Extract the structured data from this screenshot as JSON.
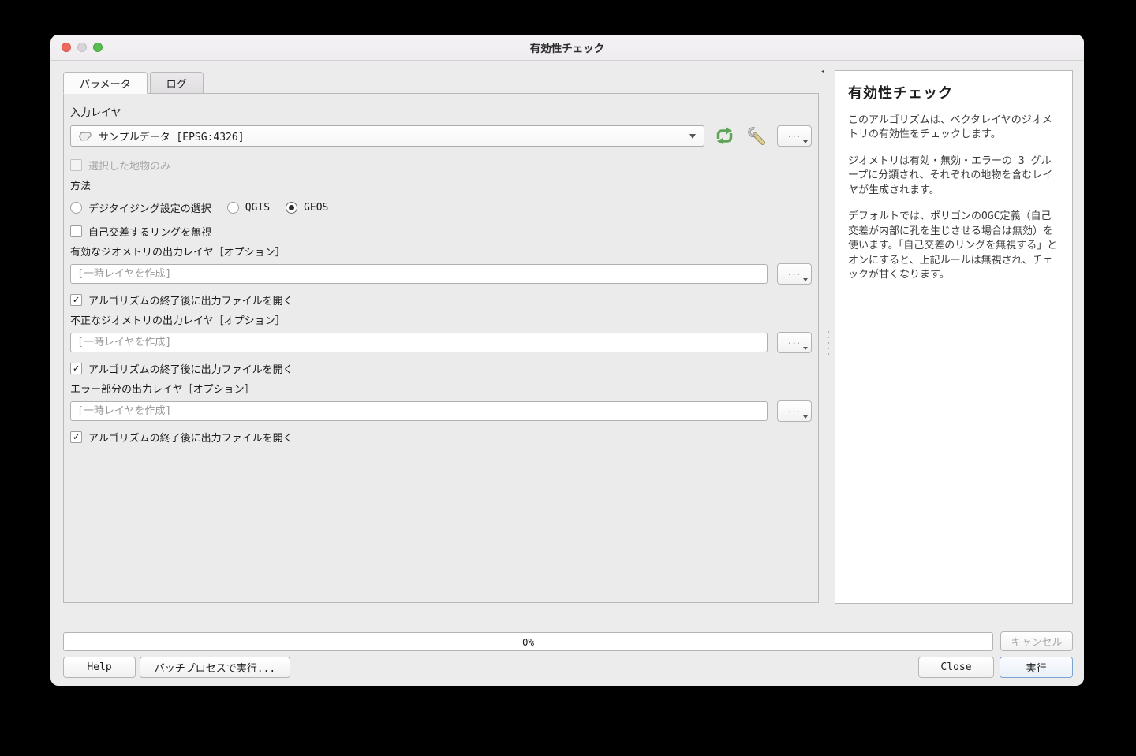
{
  "window": {
    "title": "有効性チェック"
  },
  "tabs": [
    {
      "label": "パラメータ",
      "active": true
    },
    {
      "label": "ログ",
      "active": false
    }
  ],
  "form": {
    "dots_label": "···",
    "input_layer": {
      "label": "入力レイヤ",
      "value": "サンプルデータ [EPSG:4326]"
    },
    "selected_only": {
      "label": "選択した地物のみ",
      "checked": false,
      "disabled": true
    },
    "method": {
      "label": "方法",
      "options": [
        {
          "label": "デジタイジング設定の選択",
          "selected": false
        },
        {
          "label": "QGIS",
          "selected": false
        },
        {
          "label": "GEOS",
          "selected": true
        }
      ]
    },
    "ignore_ring": {
      "label": "自己交差するリングを無視",
      "checked": false
    },
    "valid_output": {
      "label": "有効なジオメトリの出力レイヤ［オプション］",
      "placeholder": "[一時レイヤを作成]"
    },
    "invalid_output": {
      "label": "不正なジオメトリの出力レイヤ［オプション］",
      "placeholder": "[一時レイヤを作成]"
    },
    "error_output": {
      "label": "エラー部分の出力レイヤ［オプション］",
      "placeholder": "[一時レイヤを作成]"
    },
    "open_after": {
      "label": "アルゴリズムの終了後に出力ファイルを開く",
      "checked": true
    }
  },
  "help_panel": {
    "title": "有効性チェック",
    "paragraphs": [
      "このアルゴリズムは、ベクタレイヤのジオメトリの有効性をチェックします。",
      "ジオメトリは有効・無効・エラーの 3 グループに分類され、それぞれの地物を含むレイヤが生成されます。",
      "デフォルトでは、ポリゴンのOGC定義（自己交差が内部に孔を生じさせる場合は無効）を使います。「自己交差のリングを無視する」とオンにすると、上記ルールは無視され、チェックが甘くなります。"
    ]
  },
  "footer": {
    "progress": "0%",
    "cancel_label": "キャンセル",
    "help_label": "Help",
    "batch_label": "バッチプロセスで実行...",
    "close_label": "Close",
    "run_label": "実行"
  },
  "colors": {
    "accent_green": "#5ea457",
    "run_border": "#7da3d4",
    "traffic_red": "#ee6a5f",
    "traffic_green": "#58bf4e"
  }
}
